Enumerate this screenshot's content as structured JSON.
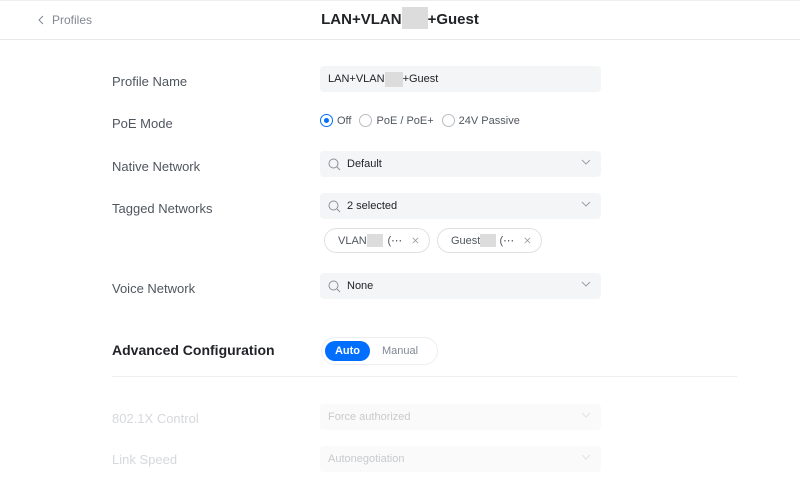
{
  "header": {
    "back_label": "Profiles",
    "title_prefix": "LAN+VLAN",
    "title_suffix": "+Guest"
  },
  "form": {
    "profile_name": {
      "label": "Profile Name",
      "value_prefix": "LAN+VLAN",
      "value_suffix": "+Guest"
    },
    "poe_mode": {
      "label": "PoE Mode",
      "options": [
        "Off",
        "PoE / PoE+",
        "24V Passive"
      ],
      "selected": "Off"
    },
    "native_network": {
      "label": "Native Network",
      "value": "Default"
    },
    "tagged_networks": {
      "label": "Tagged Networks",
      "value": "2 selected",
      "chips": [
        {
          "prefix": "VLAN",
          "suffix": "(⋯"
        },
        {
          "prefix": "Guest",
          "suffix": "(⋯"
        }
      ]
    },
    "voice_network": {
      "label": "Voice Network",
      "value": "None"
    }
  },
  "advanced": {
    "title": "Advanced Configuration",
    "modes": [
      "Auto",
      "Manual"
    ],
    "selected": "Auto",
    "dot1x": {
      "label": "802.1X Control",
      "value": "Force authorized"
    },
    "link_speed": {
      "label": "Link Speed",
      "value": "Autonegotiation"
    }
  },
  "colors": {
    "accent": "#006fff"
  }
}
